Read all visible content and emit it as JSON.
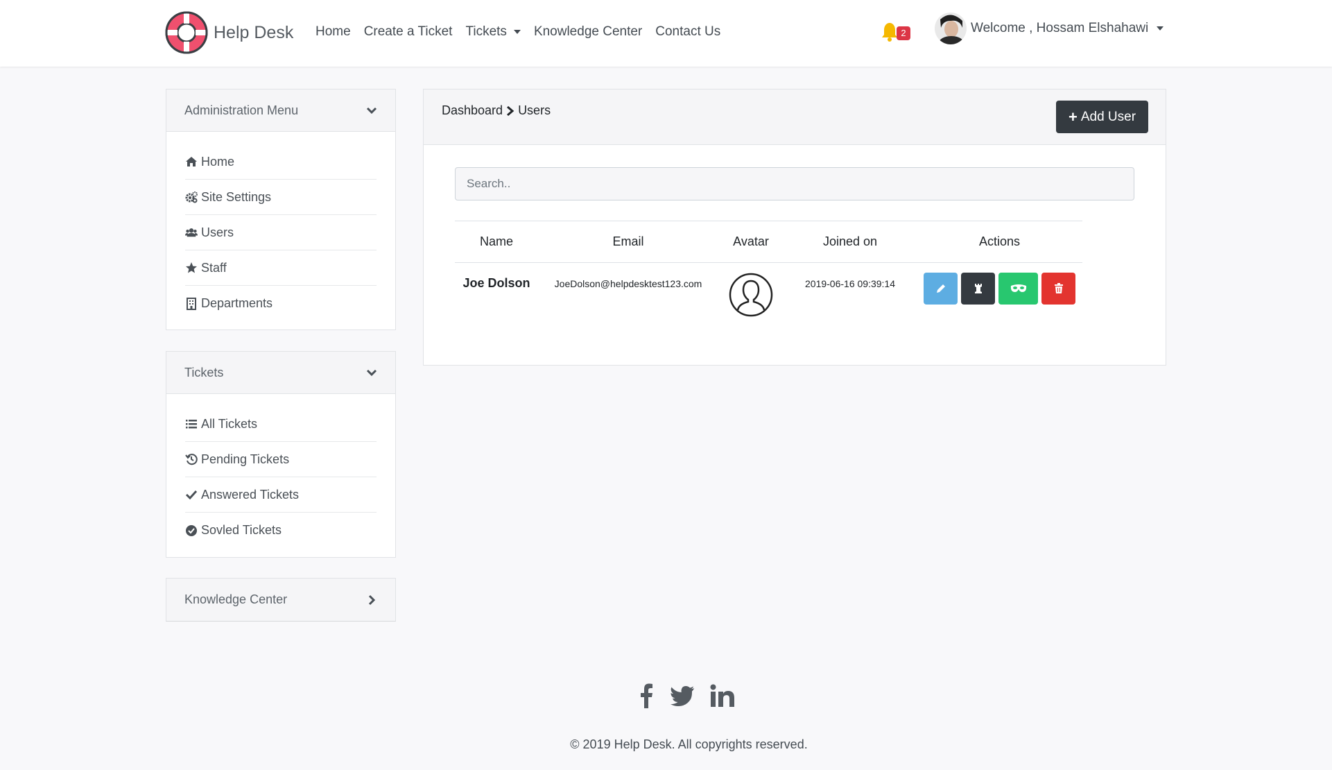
{
  "brand": {
    "name": "Help Desk",
    "accent": "#f0506e"
  },
  "nav": {
    "links": [
      "Home",
      "Create a Ticket",
      "Tickets",
      "Knowledge Center",
      "Contact Us"
    ],
    "notification_count": "2",
    "welcome": "Welcome , Hossam Elshahawi"
  },
  "sidebar": {
    "admin": {
      "title": "Administration Menu",
      "items": [
        {
          "label": "Home",
          "icon": "home-icon"
        },
        {
          "label": "Site Settings",
          "icon": "cogs-icon"
        },
        {
          "label": "Users",
          "icon": "users-icon"
        },
        {
          "label": "Staff",
          "icon": "star-icon"
        },
        {
          "label": "Departments",
          "icon": "building-icon"
        }
      ]
    },
    "tickets": {
      "title": "Tickets",
      "items": [
        {
          "label": "All Tickets",
          "icon": "list-icon"
        },
        {
          "label": "Pending Tickets",
          "icon": "history-icon"
        },
        {
          "label": "Answered Tickets",
          "icon": "check-icon"
        },
        {
          "label": "Sovled Tickets",
          "icon": "check-circle-icon"
        }
      ]
    },
    "knowledge": {
      "title": "Knowledge Center"
    }
  },
  "main": {
    "breadcrumb": [
      "Dashboard",
      "Users"
    ],
    "add_button": "Add User",
    "search_placeholder": "Search..",
    "table": {
      "headers": [
        "Name",
        "Email",
        "Avatar",
        "Joined on",
        "Actions"
      ],
      "rows": [
        {
          "name": "Joe Dolson",
          "email": "JoeDolson@helpdesktest123.com",
          "joined": "2019-06-16 09:39:14"
        }
      ]
    },
    "action_colors": {
      "edit": "#5dade2",
      "role": "#343a40",
      "impersonate": "#28c76f",
      "delete": "#e3342f"
    }
  },
  "footer": {
    "social": [
      "facebook-icon",
      "twitter-icon",
      "linkedin-icon"
    ],
    "copyright": "© 2019 Help Desk. All copyrights reserved."
  }
}
